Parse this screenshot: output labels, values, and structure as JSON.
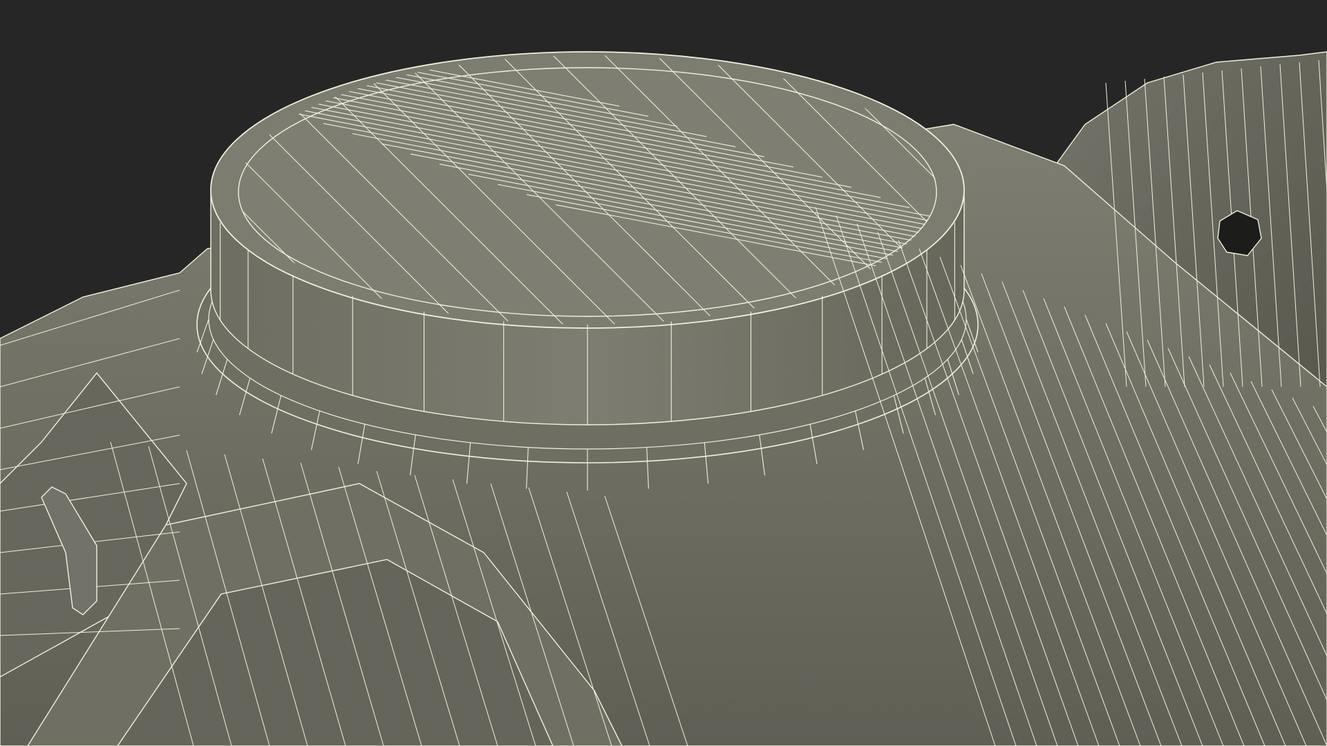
{
  "scene": {
    "background_color": "#262626",
    "surface_color": "#7b7b6e",
    "surface_shadow_color": "#5e5e53",
    "wire_color": "#f2f2df",
    "subject": "wireframe-3d-render"
  }
}
